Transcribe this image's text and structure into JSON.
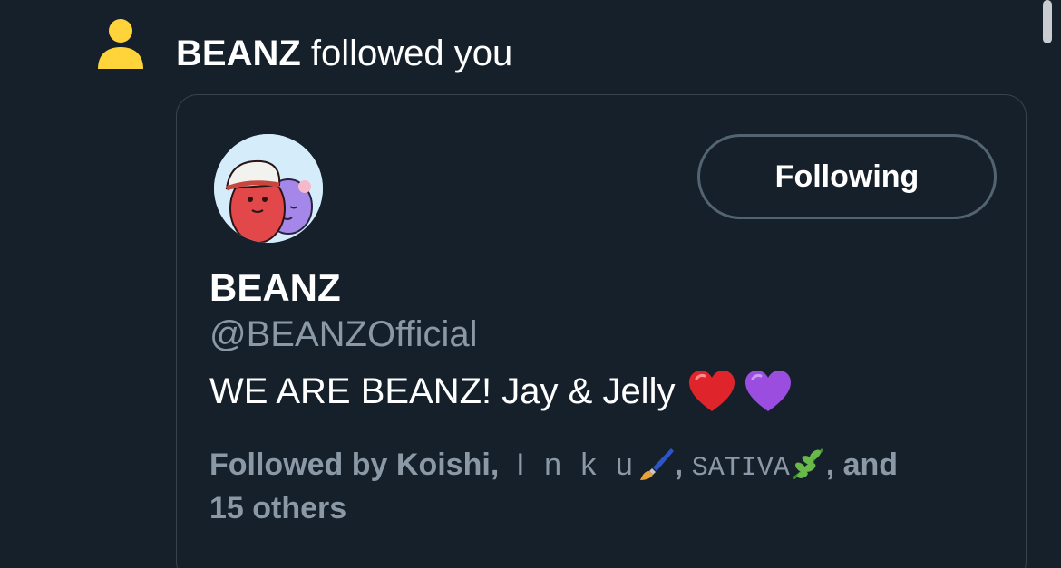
{
  "notification": {
    "icon": "person-icon",
    "actor": "BEANZ",
    "action": "followed you"
  },
  "card": {
    "avatar_icon": "beanz-avatar",
    "follow_button_label": "Following",
    "display_name": "BEANZ",
    "handle": "@BEANZOfficial",
    "bio": {
      "text": "WE ARE BEANZ! Jay & Jelly",
      "emojis": [
        "red-heart-icon",
        "purple-heart-icon"
      ]
    },
    "followed_by": {
      "prefix": "Followed by",
      "user1": "Koishi",
      "sep1": ",",
      "user2": "I n k u",
      "user2_icon": "paintbrush-icon",
      "sep2": ",",
      "user3": "SATIVA",
      "user3_icon": "herb-icon",
      "suffix": ", and",
      "others": "15 others"
    }
  },
  "colors": {
    "background": "#15202b",
    "icon_yellow": "#ffd43b",
    "text_primary": "#ffffff",
    "text_secondary": "#8b98a5",
    "border": "#38444d"
  }
}
